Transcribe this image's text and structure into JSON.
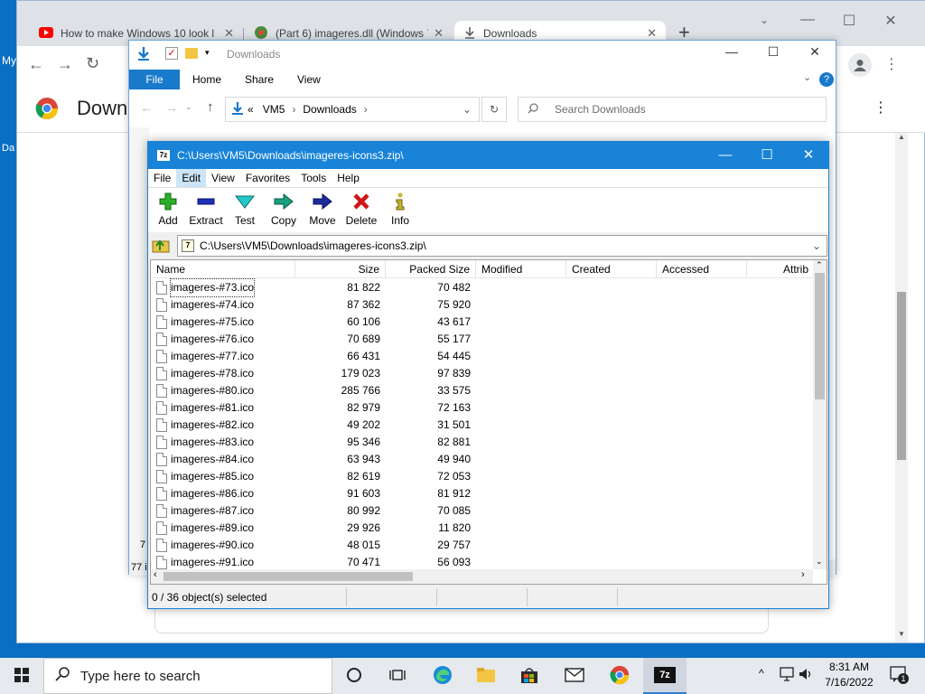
{
  "desktop": {
    "left_label_1": "My",
    "left_label_2": "Da"
  },
  "chrome": {
    "tabs": [
      {
        "title": "How to make Windows 10 look l",
        "close": "✕"
      },
      {
        "title": "(Part 6) imageres.dll (Windows 7",
        "close": "✕"
      },
      {
        "title": "Downloads",
        "close": "✕"
      }
    ],
    "new_tab": "+",
    "page_heading": "Downl"
  },
  "explorer": {
    "title": "Downloads",
    "ribbon": {
      "file": "File",
      "home": "Home",
      "share": "Share",
      "view": "View"
    },
    "address": {
      "prefix": "«",
      "segments": [
        "VM5",
        "Downloads"
      ]
    },
    "search_placeholder": "Search Downloads",
    "status_count": "77 i",
    "side_count": "7"
  },
  "zip": {
    "title": "C:\\Users\\VM5\\Downloads\\imageres-icons3.zip\\",
    "menu": [
      "File",
      "Edit",
      "View",
      "Favorites",
      "Tools",
      "Help"
    ],
    "tools": [
      "Add",
      "Extract",
      "Test",
      "Copy",
      "Move",
      "Delete",
      "Info"
    ],
    "path": "C:\\Users\\VM5\\Downloads\\imageres-icons3.zip\\",
    "columns": [
      "Name",
      "Size",
      "Packed Size",
      "Modified",
      "Created",
      "Accessed",
      "Attrib"
    ],
    "rows": [
      {
        "name": "imageres-#73.ico",
        "size": "81 822",
        "packed": "70 482"
      },
      {
        "name": "imageres-#74.ico",
        "size": "87 362",
        "packed": "75 920"
      },
      {
        "name": "imageres-#75.ico",
        "size": "60 106",
        "packed": "43 617"
      },
      {
        "name": "imageres-#76.ico",
        "size": "70 689",
        "packed": "55 177"
      },
      {
        "name": "imageres-#77.ico",
        "size": "66 431",
        "packed": "54 445"
      },
      {
        "name": "imageres-#78.ico",
        "size": "179 023",
        "packed": "97 839"
      },
      {
        "name": "imageres-#80.ico",
        "size": "285 766",
        "packed": "33 575"
      },
      {
        "name": "imageres-#81.ico",
        "size": "82 979",
        "packed": "72 163"
      },
      {
        "name": "imageres-#82.ico",
        "size": "49 202",
        "packed": "31 501"
      },
      {
        "name": "imageres-#83.ico",
        "size": "95 346",
        "packed": "82 881"
      },
      {
        "name": "imageres-#84.ico",
        "size": "63 943",
        "packed": "49 940"
      },
      {
        "name": "imageres-#85.ico",
        "size": "82 619",
        "packed": "72 053"
      },
      {
        "name": "imageres-#86.ico",
        "size": "91 603",
        "packed": "81 912"
      },
      {
        "name": "imageres-#87.ico",
        "size": "80 992",
        "packed": "70 085"
      },
      {
        "name": "imageres-#89.ico",
        "size": "29 926",
        "packed": "11 820"
      },
      {
        "name": "imageres-#90.ico",
        "size": "48 015",
        "packed": "29 757"
      },
      {
        "name": "imageres-#91.ico",
        "size": "70 471",
        "packed": "56 093"
      }
    ],
    "status": "0 / 36 object(s) selected"
  },
  "taskbar": {
    "search_placeholder": "Type here to search",
    "time": "8:31 AM",
    "date": "7/16/2022",
    "notification_count": "1"
  },
  "colors": {
    "zip_title": "#1883d7",
    "explorer_file_tab": "#1979ca",
    "taskbar": "#e6e9ee"
  }
}
